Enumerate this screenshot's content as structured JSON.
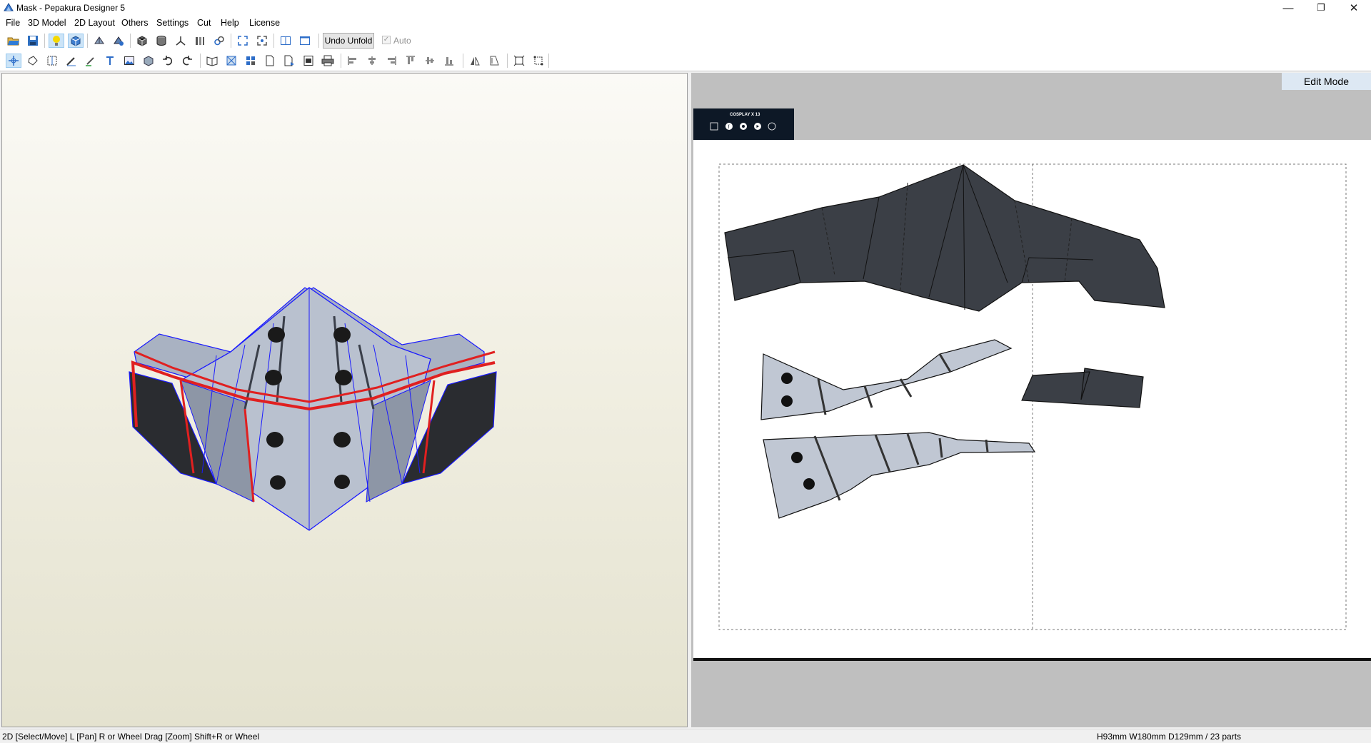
{
  "window": {
    "title": "Mask - Pepakura Designer 5",
    "controls": {
      "minimize": "—",
      "restore": "❐",
      "close": "✕"
    }
  },
  "menu": [
    "File",
    "3D Model",
    "2D Layout",
    "Others",
    "Settings",
    "Cut",
    "Help",
    "License"
  ],
  "toolbar": {
    "undo_unfold_label": "Undo Unfold",
    "auto_checkbox_label": "Auto",
    "auto_checked": true
  },
  "view2d": {
    "mode_label": "Edit Mode",
    "logo_text": "COSPLAY X 13"
  },
  "status": {
    "hint": "2D [Select/Move] L [Pan] R or Wheel Drag [Zoom] Shift+R or Wheel",
    "dimensions": "H93mm W180mm D129mm / 23 parts"
  },
  "colors": {
    "dark_part": "#3b3f46",
    "light_part": "#b8c0cc",
    "edge_blue": "#1a1aff",
    "edge_red": "#e02020",
    "accent_selected": "#cce4f7"
  }
}
